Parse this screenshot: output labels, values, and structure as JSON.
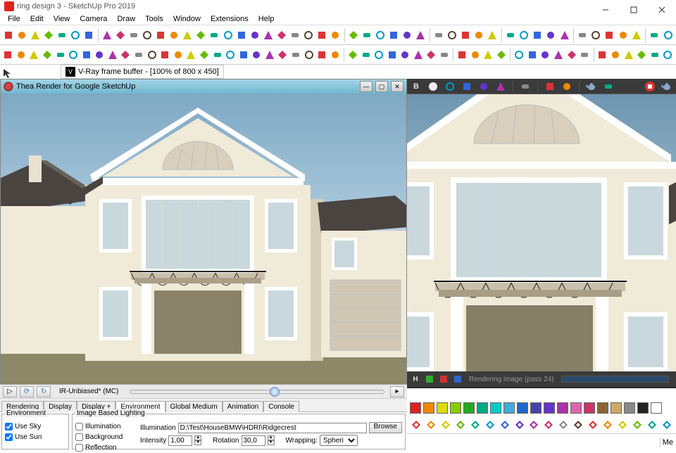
{
  "title": "ring design 3 - SketchUp Pro 2019",
  "menu": [
    "File",
    "Edit",
    "View",
    "Camera",
    "Draw",
    "Tools",
    "Window",
    "Extensions",
    "Help"
  ],
  "framebuffer_title": "V-Ray frame buffer - [100% of 800 x 450]",
  "thea_title": "Thea Render for Google SketchUp",
  "thea_ctrl": {
    "mode": "IR-Unbiased* (MC)"
  },
  "thea_tabs": [
    "Rendering",
    "Display",
    "Display +",
    "Environment",
    "Global Medium",
    "Animation",
    "Console"
  ],
  "thea_active_tab": "Environment",
  "env": {
    "group1": "Environment",
    "use_sky": {
      "label": "Use Sky",
      "checked": true
    },
    "use_sun": {
      "label": "Use Sun",
      "checked": true
    },
    "group2": "Image Based Lighting",
    "illumination_ck": {
      "label": "Illumination",
      "checked": false
    },
    "background_ck": {
      "label": "Background",
      "checked": false
    },
    "reflection_ck": {
      "label": "Reflection",
      "checked": false
    },
    "illum_label": "Illumination",
    "illum_path": "D:\\Test\\HouseBMW\\HDRI\\Ridgecrest",
    "browse": "Browse",
    "intensity_label": "Intensity",
    "intensity_val": "1,00",
    "rotation_label": "Rotation",
    "rotation_val": "30,0",
    "wrapping_label": "Wrapping:",
    "wrapping_val": "Spheri"
  },
  "vray": {
    "channel": "B",
    "status": "Rendering image (pass 24)"
  },
  "statusbar": {
    "text": "Me"
  },
  "toolbar1_icons": [
    "new",
    "open",
    "save",
    "undo",
    "redo",
    "cut",
    "print",
    "sep",
    "select",
    "eraser",
    "line",
    "arc",
    "rect",
    "circle",
    "pushpull",
    "move",
    "rotate",
    "scale",
    "offset",
    "tape",
    "text",
    "paint",
    "orbit",
    "pan",
    "zoom",
    "zoom-ext",
    "sep",
    "iso",
    "top",
    "front",
    "right",
    "back",
    "left",
    "sep",
    "user",
    "layers",
    "outliner",
    "comp",
    "3dw",
    "sep",
    "vray-render",
    "vray-rt",
    "vray-stop",
    "vray-fb",
    "vray-opt",
    "sep",
    "teapot",
    "bulb",
    "gear",
    "cube",
    "ring",
    "sep",
    "info",
    "help"
  ],
  "toolbar2_icons": [
    "sel2",
    "lasso",
    "line2",
    "freehand",
    "rect2",
    "rrect",
    "circ2",
    "poly",
    "arc2",
    "arc3",
    "pie",
    "pushpull2",
    "follow",
    "offset2",
    "move2",
    "rot2",
    "scale2",
    "tape2",
    "protractor",
    "axes",
    "dim",
    "text2",
    "section",
    "walk",
    "look",
    "position",
    "sep",
    "camera",
    "light",
    "dome",
    "sphere",
    "ies",
    "mesh",
    "proxy",
    "fur",
    "sep",
    "mat-r",
    "mat-g",
    "mat-b",
    "mat-y",
    "sep",
    "vr-a",
    "vr-b",
    "vr-c",
    "vr-d",
    "vr-e",
    "vr-f",
    "sep",
    "t-a",
    "t-b",
    "t-c",
    "t-d",
    "t-e",
    "t-f"
  ],
  "vray_tb_icons": [
    "channel",
    "circle",
    "prev",
    "next",
    "save",
    "open",
    "sep",
    "clear",
    "sep",
    "grid",
    "region",
    "sep",
    "teapot",
    "comp",
    "sep-flex",
    "stop",
    "teapot2"
  ],
  "vray_status_icons": [
    "h",
    "pause",
    "skip",
    "stop2"
  ],
  "br_row1": [
    "red",
    "orange",
    "yellow",
    "lime",
    "green",
    "teal",
    "cyan",
    "sky",
    "blue",
    "indigo",
    "violet",
    "magenta",
    "pink",
    "rose",
    "brown",
    "tan",
    "gray",
    "black",
    "white"
  ],
  "br_row2_labels": [
    "=",
    "→",
    "|",
    "↑",
    "↓",
    "←",
    "⊕",
    "⊗"
  ]
}
